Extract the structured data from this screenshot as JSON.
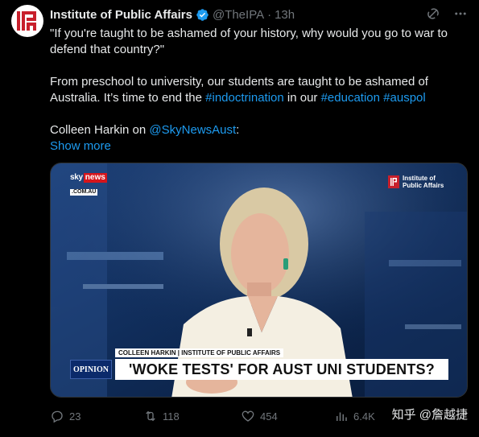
{
  "author": {
    "name": "Institute of Public Affairs",
    "handle": "@TheIPA",
    "time": "13h",
    "separator": "·"
  },
  "tweet": {
    "line1": "\"If you're taught to be ashamed of your history, why would you go to war to defend that country?\"",
    "line2_prefix": "From preschool to university, our students are taught to be ashamed of Australia. It’s time to end the ",
    "hashtag_indoctrination": "#indoctrination",
    "line2_mid": " in our ",
    "hashtag_education": "#education",
    "hashtag_auspol": "#auspol",
    "line3_prefix": "Colleen Harkin on ",
    "mention": "@SkyNewsAust",
    "line3_suffix": ":",
    "show_more": "Show more"
  },
  "media": {
    "channel_logo_sky": "sky",
    "channel_logo_news": "news",
    "channel_logo_domain": ".COM.AU",
    "ipa_logo_text": "Institute of Public Affairs",
    "name_strap": "COLLEEN HARKIN | INSTITUTE OF PUBLIC AFFAIRS",
    "opinion_tag": "OPINION",
    "headline": "'WOKE TESTS' FOR AUST UNI STUDENTS?"
  },
  "actions": {
    "replies": "23",
    "reposts": "118",
    "likes": "454",
    "views": "6.4K"
  },
  "watermark": "知乎 @詹越捷",
  "colors": {
    "background": "#000000",
    "text": "#e7e9ea",
    "muted": "#71767b",
    "link": "#1d9bf0",
    "verified": "#1d9bf0",
    "brand_red": "#c8202c"
  }
}
